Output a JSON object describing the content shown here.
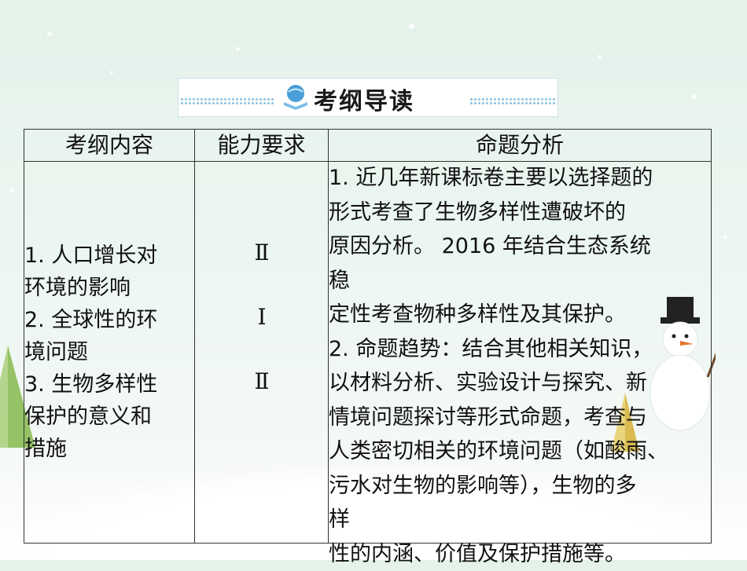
{
  "banner": {
    "title": "考纲导读",
    "icon": "book-globe-icon"
  },
  "table": {
    "headers": [
      "考纲内容",
      "能力要求",
      "命题分析"
    ],
    "content_lines": [
      "1. 人口增长对",
      "环境的影响",
      "2. 全球性的环",
      "境问题",
      "3. 生物多样性",
      "保护的意义和",
      "措施"
    ],
    "levels": [
      "Ⅱ",
      "Ⅰ",
      "Ⅱ"
    ],
    "analysis_lines": [
      "1. 近几年新课标卷主要以选择题的",
      "形式考查了生物多样性遭破坏的",
      "原因分析。 2016  年结合生态系统",
      "稳",
      "定性考查物种多样性及其保护。",
      "2. 命题趋势：结合其他相关知识，",
      "以材料分析、实验设计与探究、新",
      "情境问题探讨等形式命题，考查与",
      "人类密切相关的环境问题（如酸雨、",
      "污水对生物的影响等），生物的多",
      "样",
      "性的内涵、价值及保护措施等。"
    ]
  },
  "colors": {
    "background": "#e4f2ea",
    "border": "#333333",
    "accent": "#8fc3e4"
  }
}
